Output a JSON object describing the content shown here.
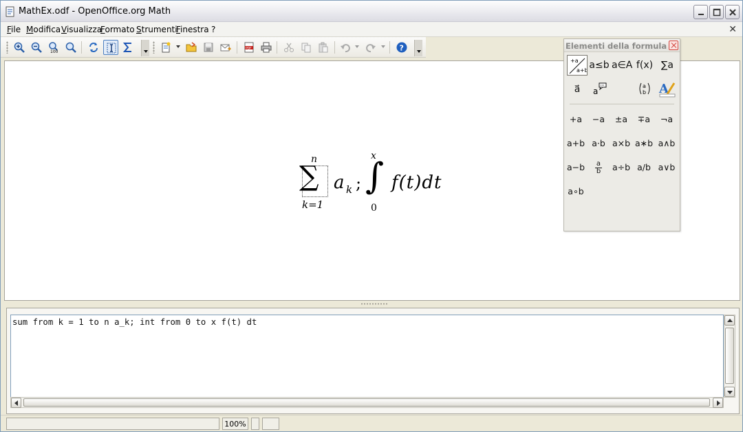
{
  "window": {
    "title": "MathEx.odf - OpenOffice.org Math"
  },
  "menu": {
    "items": [
      "File",
      "Modifica",
      "Visualizza",
      "Formato",
      "Strumenti",
      "Finestra",
      "?"
    ]
  },
  "toolbar": {
    "icons": [
      "zoom-in-icon",
      "zoom-out-icon",
      "zoom-100-icon",
      "zoom-page-icon",
      "update-icon",
      "formula-cursor-icon",
      "symbols-icon",
      "new-icon",
      "open-icon",
      "save-icon",
      "email-icon",
      "export-pdf-icon",
      "print-icon",
      "cut-icon",
      "copy-icon",
      "paste-icon",
      "undo-icon",
      "redo-icon",
      "help-icon"
    ]
  },
  "formula_display": {
    "upper_limit_sum": "n",
    "lower_limit_sum": "k=1",
    "term": "a",
    "term_subscript": "k",
    "separator": ";",
    "upper_limit_int": "x",
    "lower_limit_int": "0",
    "integrand": "f(t)dt"
  },
  "command_editor": {
    "text": "sum from k = 1 to n a_k; int from 0 to x f(t) dt"
  },
  "statusbar": {
    "zoom": "100%"
  },
  "elements_panel": {
    "title": "Elementi della formula",
    "categories_row1": [
      "",
      "a≤b",
      "a∈A",
      "f(x)",
      "∑a"
    ],
    "categories_row2": [
      "a⃗",
      "a",
      "",
      "(a b)",
      ""
    ],
    "operators": [
      [
        "+a",
        "−a",
        "±a",
        "∓a",
        "¬a"
      ],
      [
        "a+b",
        "a·b",
        "a×b",
        "a∗b",
        "a∧b"
      ],
      [
        "a−b",
        "",
        "a÷b",
        "a/b",
        "a∨b"
      ],
      [
        "a∘b"
      ]
    ],
    "fraction": {
      "numerator": "a",
      "denominator": "b"
    }
  }
}
